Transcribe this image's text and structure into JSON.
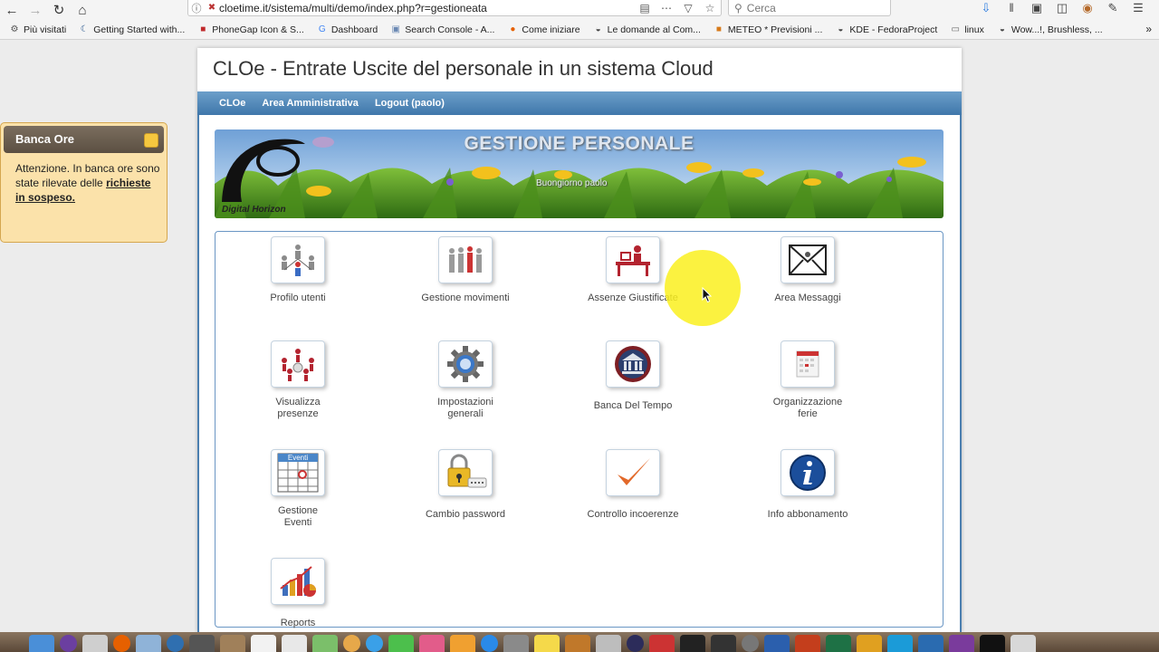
{
  "browser": {
    "url": "cloetime.it/sistema/multi/demo/index.php?r=gestioneata",
    "search_placeholder": "Cerca"
  },
  "bookmarks": [
    {
      "label": "Più visitati",
      "icon": "gear-icon",
      "color": "#555555"
    },
    {
      "label": "Getting Started with...",
      "icon": "crescent-icon",
      "color": "#1d4e89"
    },
    {
      "label": "PhoneGap Icon & S...",
      "icon": "square-icon",
      "color": "#c0292b"
    },
    {
      "label": "Dashboard",
      "icon": "google-icon",
      "color": "#4285f4"
    },
    {
      "label": "Search Console - A...",
      "icon": "console-icon",
      "color": "#6a88b3"
    },
    {
      "label": "Come iniziare",
      "icon": "firefox-icon",
      "color": "#e66000"
    },
    {
      "label": "Le domande al Com...",
      "icon": "globe-icon",
      "color": "#444444"
    },
    {
      "label": "METEO * Previsioni ...",
      "icon": "meteo-icon",
      "color": "#d77a1a"
    },
    {
      "label": "KDE - FedoraProject",
      "icon": "globe-icon",
      "color": "#444444"
    },
    {
      "label": "linux",
      "icon": "folder-icon",
      "color": "#666666"
    },
    {
      "label": "Wow...!, Brushless, ...",
      "icon": "globe-icon",
      "color": "#444444"
    }
  ],
  "header": {
    "title": "CLOe - Entrate Uscite del personale in un sistema Cloud"
  },
  "nav": {
    "items": [
      "CLOe",
      "Area Amministrativa",
      "Logout (paolo)"
    ]
  },
  "banner": {
    "title": "GESTIONE PERSONALE",
    "greeting": "Buongiorno paolo",
    "brand": "Digital Horizon"
  },
  "tiles": [
    {
      "label": "Profilo utenti",
      "icon": "people-network-icon"
    },
    {
      "label": "Gestione movimenti",
      "icon": "people-walking-icon"
    },
    {
      "label": "Assenze Giustificate",
      "icon": "desk-icon"
    },
    {
      "label": "Area Messaggi",
      "icon": "envelope-icon"
    },
    {
      "label": "Visualizza presenze",
      "icon": "people-circle-icon"
    },
    {
      "label": "Impostazioni generali",
      "icon": "gear-icon"
    },
    {
      "label": "Banca Del Tempo",
      "icon": "bank-icon"
    },
    {
      "label": "Organizzazione ferie",
      "icon": "calendar-icon"
    },
    {
      "label": "Gestione Eventi",
      "icon": "events-calendar-icon",
      "badge": "Eventi"
    },
    {
      "label": "Cambio password",
      "icon": "padlock-icon"
    },
    {
      "label": "Controllo incoerenze",
      "icon": "checkmark-icon"
    },
    {
      "label": "Info abbonamento",
      "icon": "info-icon"
    },
    {
      "label": "Reports",
      "icon": "chart-icon"
    }
  ],
  "sidepanel": {
    "title": "Banca Ore",
    "text": "Attenzione. In banca ore sono state rilevate delle",
    "link": "richieste in sospeso."
  },
  "colors": {
    "nav_gradient_top": "#6c9fca",
    "nav_gradient_bottom": "#3f77aa",
    "panel_bg": "#fbe2aa",
    "highlight": "#faf01e"
  }
}
